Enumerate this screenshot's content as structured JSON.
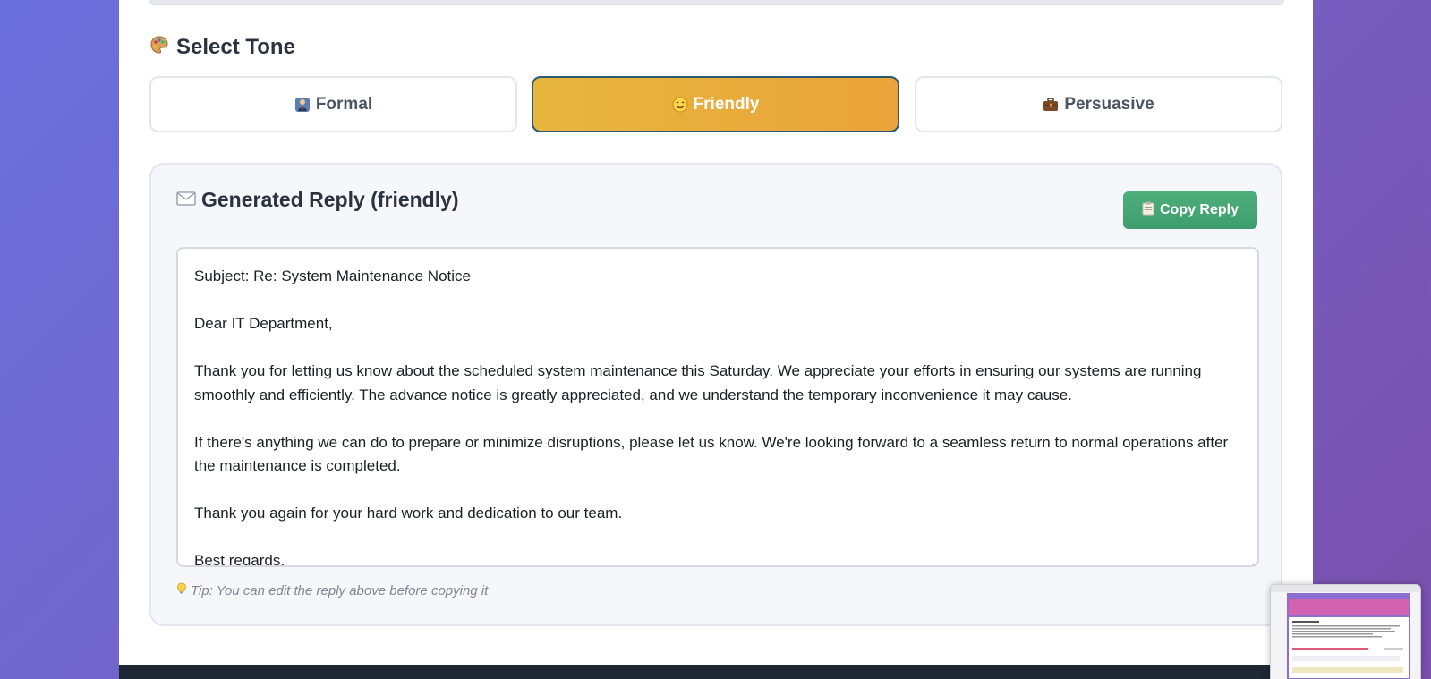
{
  "tone_section": {
    "icon": "palette-icon",
    "title": "Select Tone",
    "options": [
      {
        "label": "Formal",
        "icon": "necktie-person-icon"
      },
      {
        "label": "Friendly",
        "icon": "smiley-face-icon",
        "selected": true
      },
      {
        "label": "Persuasive",
        "icon": "briefcase-icon"
      }
    ]
  },
  "reply_section": {
    "icon": "envelope-icon",
    "title": "Generated Reply (friendly)",
    "copy_button": {
      "label": "Copy Reply",
      "icon": "clipboard-icon"
    },
    "reply_text": {
      "subject": "Subject: Re: System Maintenance Notice",
      "greeting": "Dear IT Department,",
      "paragraph_1": "Thank you for letting us know about the scheduled system maintenance this Saturday. We appreciate your efforts in ensuring our systems are running smoothly and efficiently. The advance notice is greatly appreciated, and we understand the temporary inconvenience it may cause.",
      "paragraph_2": "If there's anything we can do to prepare or minimize disruptions, please let us know. We're looking forward to a seamless return to normal operations after the maintenance is completed.",
      "paragraph_3": "Thank you again for your hard work and dedication to our team.",
      "closing": "Best regards,"
    },
    "tip": {
      "icon": "lightbulb-icon",
      "text": "Tip: You can edit the reply above before copying it"
    }
  },
  "colors": {
    "background_gradient_start": "#6b70dd",
    "background_gradient_end": "#7a50ad",
    "selected_tone": "#e9a33a",
    "selected_tone_border": "#2b5a76",
    "copy_button": "#45a574",
    "footer": "#1f2734"
  }
}
